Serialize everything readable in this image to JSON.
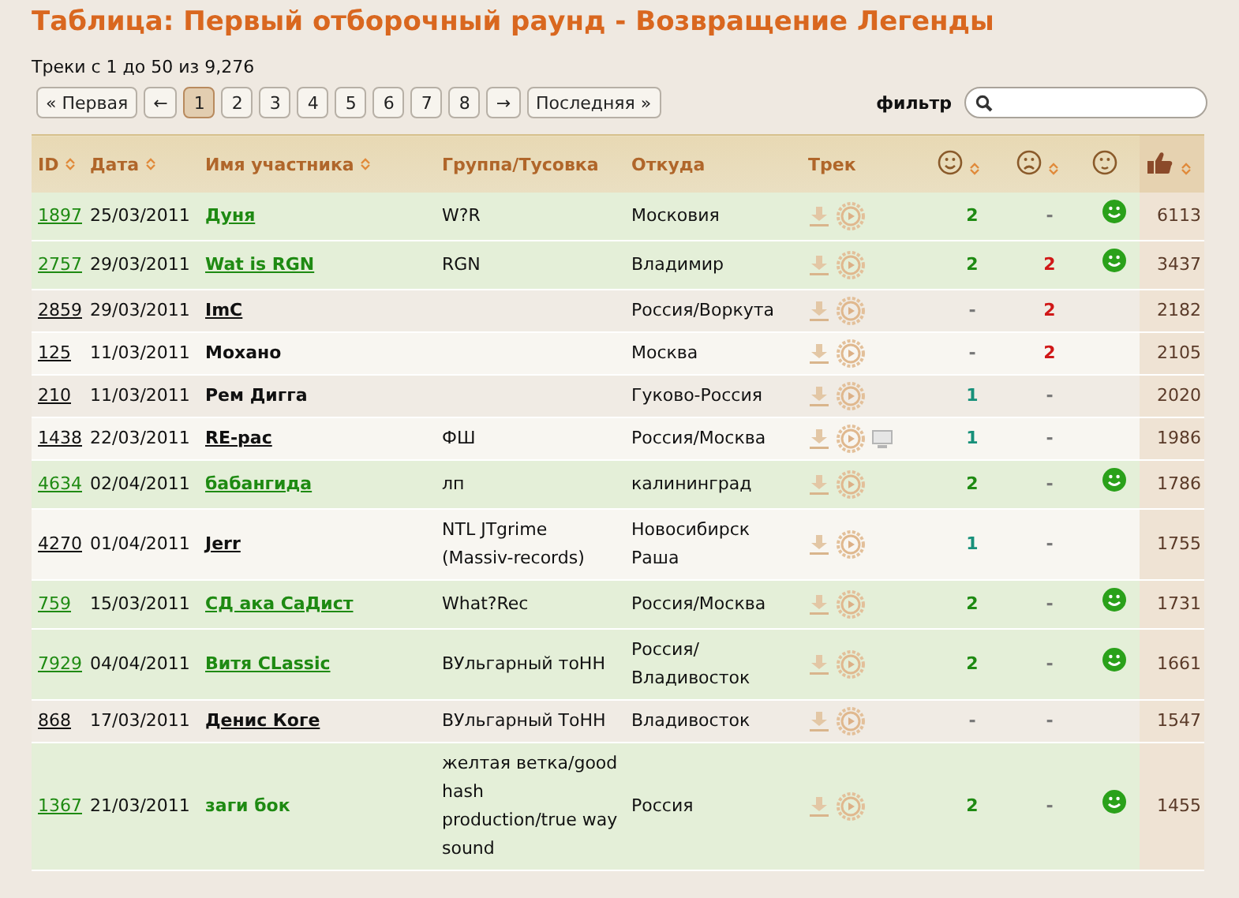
{
  "title": "Таблица: Первый отборочный раунд - Возвращение Легенды",
  "summary": "Треки с 1 до 50 из 9,276",
  "pagination": [
    {
      "label": "« Первая",
      "selected": false
    },
    {
      "label": "←",
      "selected": false
    },
    {
      "label": "1",
      "selected": true
    },
    {
      "label": "2",
      "selected": false
    },
    {
      "label": "3",
      "selected": false
    },
    {
      "label": "4",
      "selected": false
    },
    {
      "label": "5",
      "selected": false
    },
    {
      "label": "6",
      "selected": false
    },
    {
      "label": "7",
      "selected": false
    },
    {
      "label": "8",
      "selected": false
    },
    {
      "label": "→",
      "selected": false
    },
    {
      "label": "Последняя »",
      "selected": false
    }
  ],
  "filter": {
    "label": "фильтр"
  },
  "columns": [
    {
      "label": "ID",
      "sortable": true
    },
    {
      "label": "Дата",
      "sortable": true
    },
    {
      "label": "Имя участника",
      "sortable": true
    },
    {
      "label": "Группа/Тусовка",
      "sortable": false
    },
    {
      "label": "Откуда",
      "sortable": false
    },
    {
      "label": "Трек",
      "sortable": false
    },
    {
      "kind": "smile",
      "sortable": true
    },
    {
      "kind": "sad",
      "sortable": true
    },
    {
      "kind": "neutral",
      "sortable": false
    },
    {
      "kind": "thumb",
      "sortable": true
    }
  ],
  "rows": [
    {
      "id": "1897",
      "date": "25/03/2011",
      "name": "Дуня",
      "name_link": true,
      "group": "W?R",
      "from": "Московия",
      "video": false,
      "likes": "2",
      "dislikes": "-",
      "approved": true,
      "score": "6113"
    },
    {
      "id": "2757",
      "date": "29/03/2011",
      "name": "Wat is RGN",
      "name_link": true,
      "group": "RGN",
      "from": "Владимир",
      "video": false,
      "likes": "2",
      "dislikes": "2",
      "approved": true,
      "score": "3437"
    },
    {
      "id": "2859",
      "date": "29/03/2011",
      "name": "ImC",
      "name_link": true,
      "group": "",
      "from": "Россия/Воркута",
      "video": false,
      "likes": "-",
      "dislikes": "2",
      "approved": false,
      "score": "2182"
    },
    {
      "id": "125",
      "date": "11/03/2011",
      "name": "Мохано",
      "name_link": false,
      "group": "",
      "from": "Москва",
      "video": false,
      "likes": "-",
      "dislikes": "2",
      "approved": false,
      "score": "2105"
    },
    {
      "id": "210",
      "date": "11/03/2011",
      "name": "Рем Дигга",
      "name_link": false,
      "group": "",
      "from": "Гуково-Россия",
      "video": false,
      "likes": "1",
      "dislikes": "-",
      "approved": false,
      "score": "2020"
    },
    {
      "id": "1438",
      "date": "22/03/2011",
      "name": "RE-рас",
      "name_link": true,
      "group": "ФШ",
      "from": "Россия/Москва",
      "video": true,
      "likes": "1",
      "dislikes": "-",
      "approved": false,
      "score": "1986"
    },
    {
      "id": "4634",
      "date": "02/04/2011",
      "name": "бабангида",
      "name_link": true,
      "group": "лп",
      "from": "калининград",
      "video": false,
      "likes": "2",
      "dislikes": "-",
      "approved": true,
      "score": "1786"
    },
    {
      "id": "4270",
      "date": "01/04/2011",
      "name": "Jerr",
      "name_link": true,
      "group": "NTL JTgrime (Massiv-records)",
      "from": "Новосибирск Раша",
      "video": false,
      "likes": "1",
      "dislikes": "-",
      "approved": false,
      "score": "1755"
    },
    {
      "id": "759",
      "date": "15/03/2011",
      "name": "СД ака СаДист",
      "name_link": true,
      "group": "What?Rec",
      "from": "Россия/Москва",
      "video": false,
      "likes": "2",
      "dislikes": "-",
      "approved": true,
      "score": "1731"
    },
    {
      "id": "7929",
      "date": "04/04/2011",
      "name": "Витя CLassic",
      "name_link": true,
      "group": "ВУльгарный тоНН",
      "from": "Россия/ Владивосток",
      "video": false,
      "likes": "2",
      "dislikes": "-",
      "approved": true,
      "score": "1661"
    },
    {
      "id": "868",
      "date": "17/03/2011",
      "name": "Денис Коге",
      "name_link": true,
      "group": "ВУльгарный ТоНН",
      "from": "Владивосток",
      "video": false,
      "likes": "-",
      "dislikes": "-",
      "approved": false,
      "score": "1547"
    },
    {
      "id": "1367",
      "date": "21/03/2011",
      "name": "заги бок",
      "name_link": false,
      "group": "желтая ветка/good hash production/true way sound",
      "from": "Россия",
      "video": false,
      "likes": "2",
      "dislikes": "-",
      "approved": true,
      "score": "1455"
    }
  ]
}
